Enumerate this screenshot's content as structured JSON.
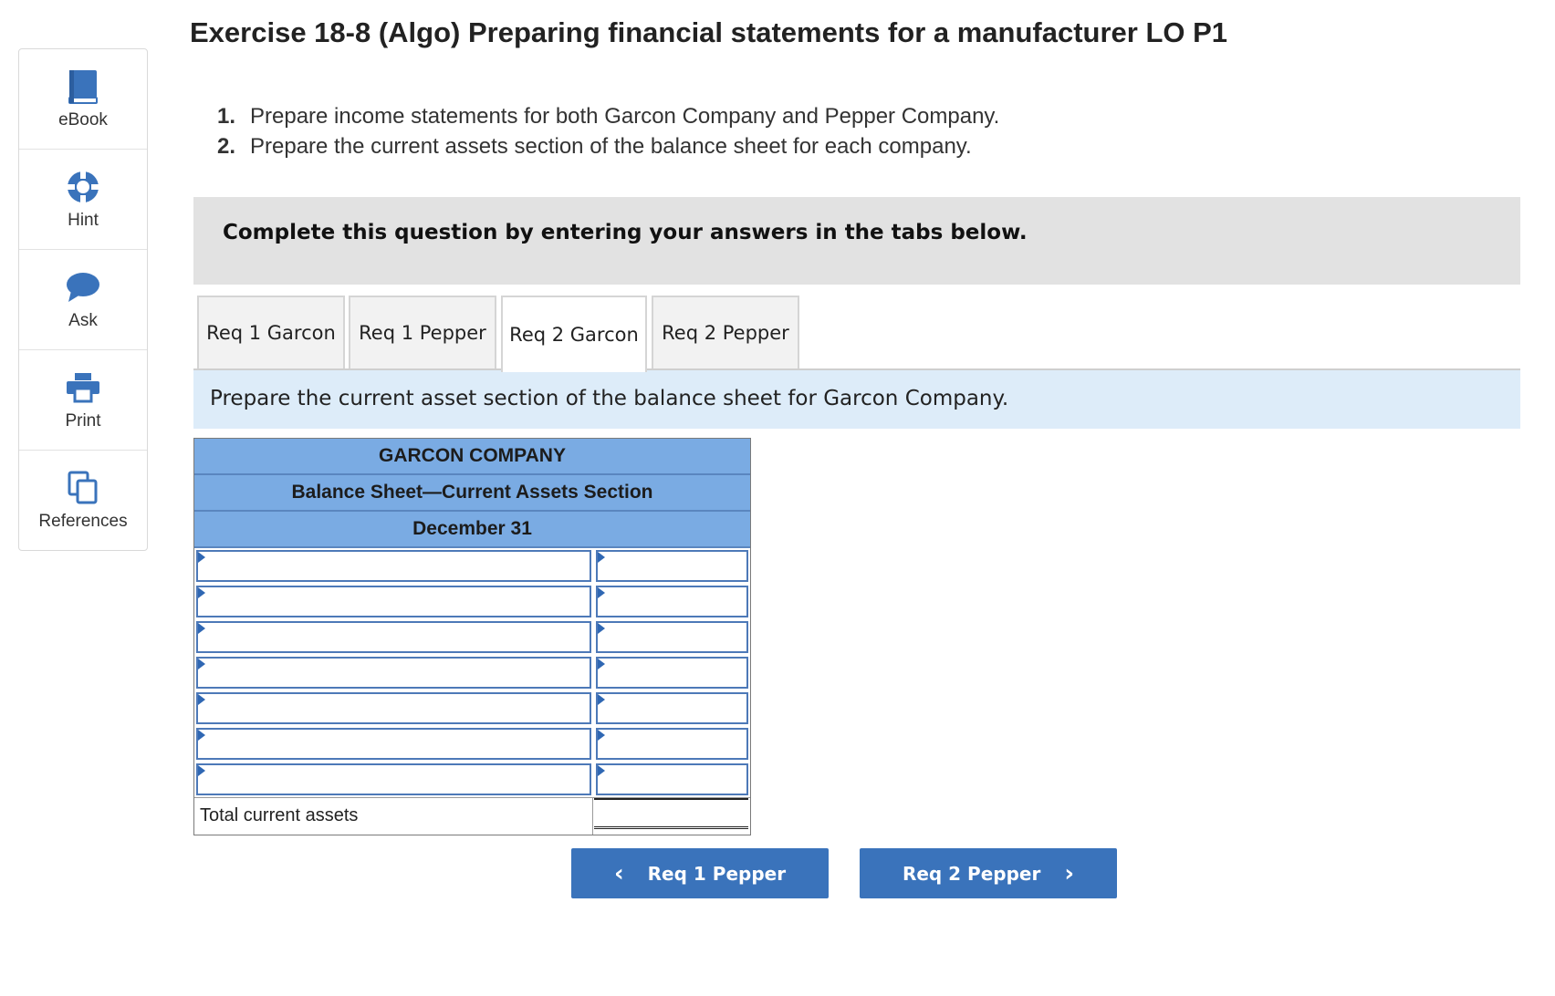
{
  "sidebar": {
    "items": [
      {
        "label": "eBook",
        "icon": "book-icon"
      },
      {
        "label": "Hint",
        "icon": "lifebuoy-icon"
      },
      {
        "label": "Ask",
        "icon": "speech-bubble-icon"
      },
      {
        "label": "Print",
        "icon": "printer-icon"
      },
      {
        "label": "References",
        "icon": "copy-documents-icon"
      }
    ]
  },
  "title": "Exercise 18-8 (Algo) Preparing financial statements for a manufacturer LO P1",
  "instructions": [
    {
      "num": "1.",
      "text": "Prepare income statements for both Garcon Company and Pepper Company."
    },
    {
      "num": "2.",
      "text": "Prepare the current assets section of the balance sheet for each company."
    }
  ],
  "banner": "Complete this question by entering your answers in the tabs below.",
  "tabs": [
    {
      "label": "Req 1 Garcon",
      "active": false
    },
    {
      "label": "Req 1 Pepper",
      "active": false
    },
    {
      "label": "Req 2 Garcon",
      "active": true
    },
    {
      "label": "Req 2 Pepper",
      "active": false
    }
  ],
  "prompt": "Prepare the current asset section of the balance sheet for Garcon Company.",
  "sheet": {
    "company": "GARCON COMPANY",
    "statement": "Balance Sheet—Current Assets Section",
    "date": "December 31",
    "rows": [
      {
        "label": "",
        "amount": ""
      },
      {
        "label": "",
        "amount": ""
      },
      {
        "label": "",
        "amount": ""
      },
      {
        "label": "",
        "amount": ""
      },
      {
        "label": "",
        "amount": ""
      },
      {
        "label": "",
        "amount": ""
      },
      {
        "label": "",
        "amount": ""
      }
    ],
    "total_label": "Total current assets",
    "total_value": ""
  },
  "nav": {
    "prev_label": "Req 1 Pepper",
    "next_label": "Req 2 Pepper"
  },
  "colors": {
    "accent": "#3a73bb",
    "header_fill": "#7aabe3",
    "prompt_fill": "#ddecf9",
    "banner_fill": "#e2e2e2"
  }
}
